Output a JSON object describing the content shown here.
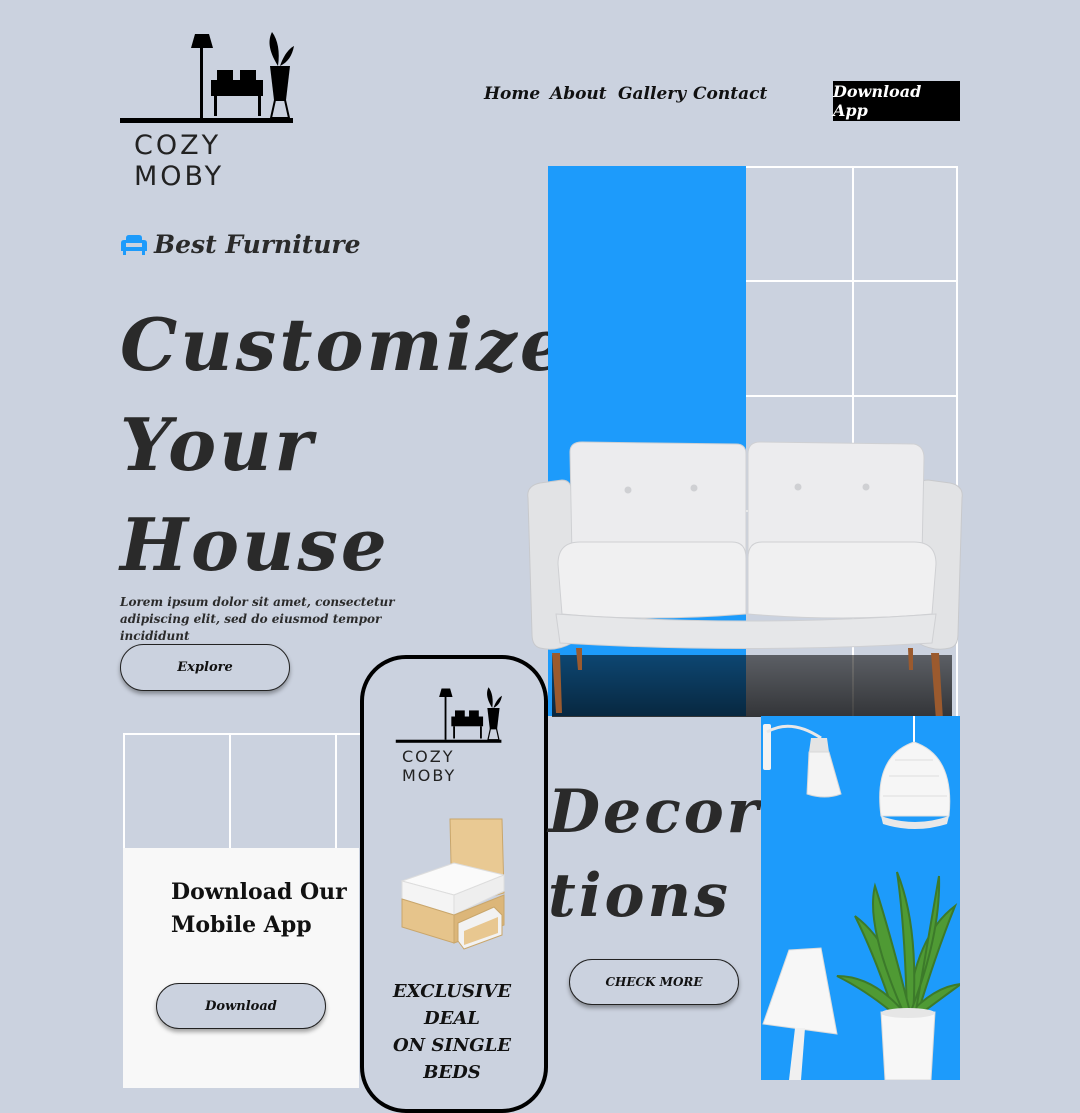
{
  "brand": {
    "name": "COZY MOBY"
  },
  "nav": {
    "items": [
      "Home",
      "About",
      "Gallery",
      "Contact"
    ],
    "cta": "Download App"
  },
  "hero": {
    "tag": "Best Furniture",
    "title_lines": [
      "Customize",
      "Your",
      "House"
    ],
    "description": "Lorem ipsum dolor sit amet, consectetur adipiscing elit, sed do eiusmod tempor incididunt",
    "button": "Explore"
  },
  "app_card": {
    "title_line1": "Download Our",
    "title_line2": "Mobile App",
    "button": "Download"
  },
  "phone": {
    "brand": "COZY MOBY",
    "deal_line1": "EXCLUSIVE DEAL",
    "deal_line2": "ON SINGLE BEDS"
  },
  "decorations": {
    "line1": "Decora-",
    "line2": "tions",
    "button": "CHECK MORE"
  },
  "colors": {
    "accent": "#1d9bfb",
    "background": "#cbd2df",
    "dark": "#000000"
  },
  "icons": {
    "tag": "armchair-icon"
  }
}
